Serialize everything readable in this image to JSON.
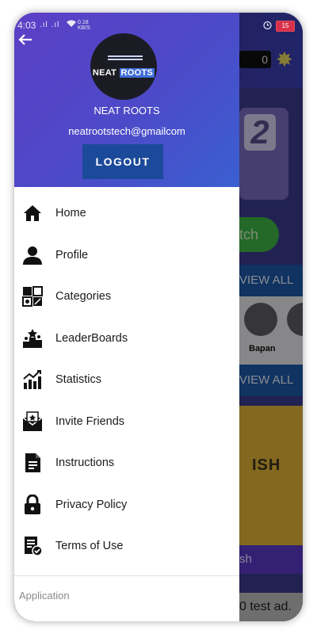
{
  "status_bar": {
    "time": "4:03",
    "signal": ".ıl .ıl",
    "net_speed_value": "0.18",
    "net_speed_unit": "KB/S",
    "battery": "15"
  },
  "background_app": {
    "coins": "0",
    "green_button": "tch",
    "view_all_1": "VIEW ALL",
    "view_all_2": "VIEW ALL",
    "leader_name": "Bapan",
    "book_text": "ISH",
    "purple_bar": "sh",
    "ad_text": "0 test ad."
  },
  "drawer": {
    "logo": {
      "word1": "NEAT",
      "word2": "ROOTS"
    },
    "brand_name": "NEAT ROOTS",
    "email": "neatrootstech@gmailcom",
    "logout_label": "LOGOUT",
    "menu": [
      {
        "label": "Home",
        "icon": "home-icon"
      },
      {
        "label": "Profile",
        "icon": "profile-icon"
      },
      {
        "label": "Categories",
        "icon": "categories-icon"
      },
      {
        "label": "LeaderBoards",
        "icon": "leaderboard-icon"
      },
      {
        "label": "Statistics",
        "icon": "statistics-icon"
      },
      {
        "label": "Invite Friends",
        "icon": "invite-icon"
      },
      {
        "label": "Instructions",
        "icon": "instructions-icon"
      },
      {
        "label": "Privacy Policy",
        "icon": "lock-icon"
      },
      {
        "label": "Terms of Use",
        "icon": "terms-icon"
      }
    ],
    "section_label": "Application"
  },
  "colors": {
    "drawer_header_gradient_start": "#5c3fc6",
    "drawer_header_gradient_end": "#3a5fd0",
    "logout_button": "#1c4a9a",
    "accent_blue": "#1d58a8",
    "green_button": "#3fb545"
  }
}
